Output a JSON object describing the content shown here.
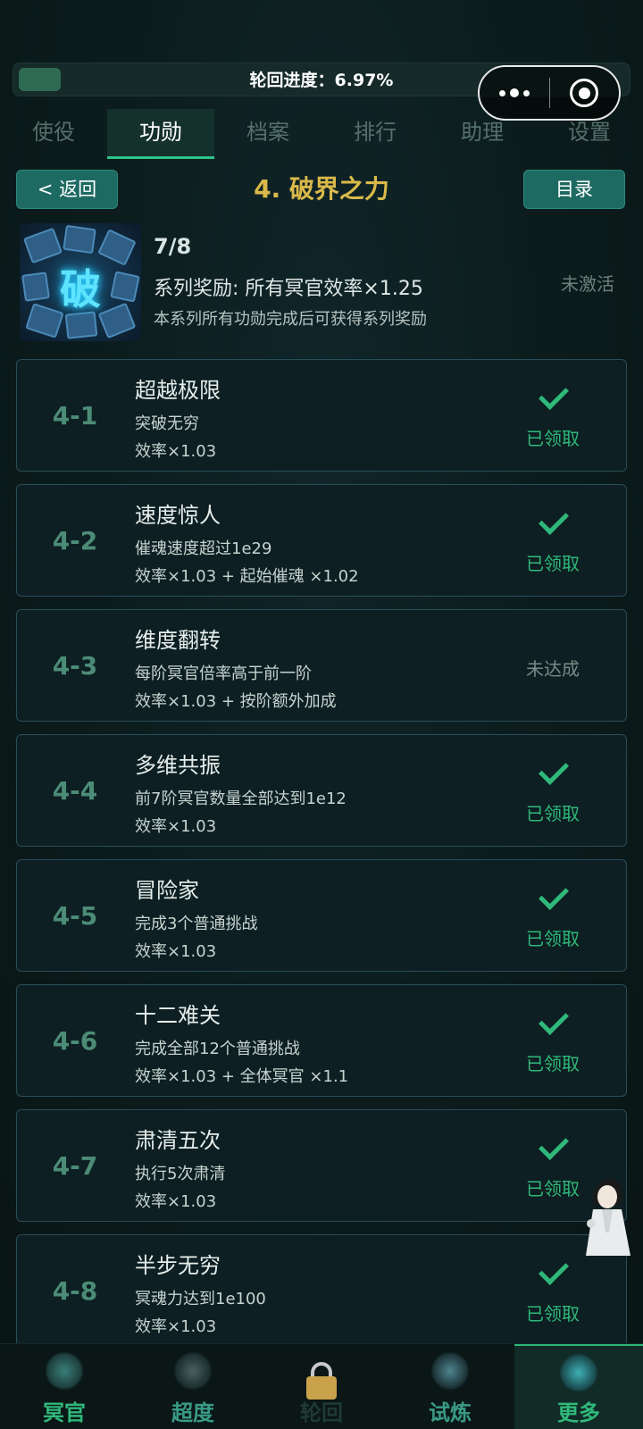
{
  "progress": {
    "label": "轮回进度：6.97%",
    "fraction": 0.0697
  },
  "tabs": [
    {
      "label": "使役"
    },
    {
      "label": "功勋"
    },
    {
      "label": "档案"
    },
    {
      "label": "排行"
    },
    {
      "label": "助理"
    },
    {
      "label": "设置"
    }
  ],
  "header": {
    "back_label": "< 返回",
    "title": "4. 破界之力",
    "toc_label": "目录"
  },
  "series": {
    "icon_glyph": "破",
    "progress": "7/8",
    "reward": "系列奖励: 所有冥官效率×1.25",
    "hint": "本系列所有功勋完成后可获得系列奖励",
    "status": "未激活"
  },
  "achievements": [
    {
      "num": "4-1",
      "title": "超越极限",
      "desc": "突破无穷",
      "effect": "效率×1.03",
      "status": "已领取",
      "claimed": true
    },
    {
      "num": "4-2",
      "title": "速度惊人",
      "desc": "催魂速度超过1e29",
      "effect": "效率×1.03 + 起始催魂 ×1.02",
      "status": "已领取",
      "claimed": true
    },
    {
      "num": "4-3",
      "title": "维度翻转",
      "desc": "每阶冥官倍率高于前一阶",
      "effect": "效率×1.03 + 按阶额外加成",
      "status": "未达成",
      "claimed": false
    },
    {
      "num": "4-4",
      "title": "多维共振",
      "desc": "前7阶冥官数量全部达到1e12",
      "effect": "效率×1.03",
      "status": "已领取",
      "claimed": true
    },
    {
      "num": "4-5",
      "title": "冒险家",
      "desc": "完成3个普通挑战",
      "effect": "效率×1.03",
      "status": "已领取",
      "claimed": true
    },
    {
      "num": "4-6",
      "title": "十二难关",
      "desc": "完成全部12个普通挑战",
      "effect": "效率×1.03 + 全体冥官 ×1.1",
      "status": "已领取",
      "claimed": true
    },
    {
      "num": "4-7",
      "title": "肃清五次",
      "desc": "执行5次肃清",
      "effect": "效率×1.03",
      "status": "已领取",
      "claimed": true
    },
    {
      "num": "4-8",
      "title": "半步无穷",
      "desc": "冥魂力达到1e100",
      "effect": "效率×1.03",
      "status": "已领取",
      "claimed": true
    }
  ],
  "bottom_nav": [
    {
      "label": "冥官",
      "icon": "officer-emblem-icon",
      "color": "#2fb87a"
    },
    {
      "label": "超度",
      "icon": "shrine-emblem-icon",
      "color": "#3a9b86"
    },
    {
      "label": "轮回",
      "icon": "lock-icon",
      "color": "#1f3a36"
    },
    {
      "label": "试炼",
      "icon": "trial-emblem-icon",
      "color": "#3a9b86"
    },
    {
      "label": "更多",
      "icon": "more-emblem-icon",
      "color": "#2fb87a"
    }
  ],
  "colors": {
    "accent": "#2fb87a",
    "title_gold": "#d9b94a",
    "button": "#1d6a62"
  }
}
